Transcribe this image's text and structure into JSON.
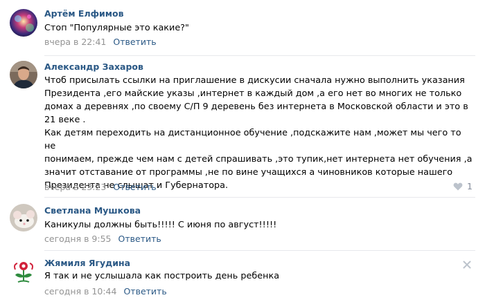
{
  "comments": [
    {
      "author": "Артём Елфимов",
      "text": "Стоп \"Популярные это какие?\"",
      "time": "вчера в 22:41",
      "reply": "Ответить",
      "avatar": "avatar-photo-colorful"
    },
    {
      "author": "Александр Захаров",
      "text": "Чтоб присылать ссылки на приглашение в дискусии сначала нужно выполнить указания\nПрезидента ,его майские указы ,интернет в каждый дом ,а его нет во многих не только\nдомах а деревнях ,по своему С/П 9 деревень без интернета в Московской области и это в\n21 веке .\nКак детям переходить на дистанционное обучение ,подскажите нам ,может мы чего то не\nпонимаем, прежде чем нам с детей спрашивать ,это тупик,нет интернета нет обучения ,а\nзначит отставание от программы ,не по вине учащихся а чиновников которые нашего\nПрезидента не слышат и Губернатора.",
      "time": "вчера в 23:23",
      "reply": "Ответить",
      "likes": "1",
      "avatar": "avatar-photo-man"
    },
    {
      "author": "Светлана Мушкова",
      "text": "Каникулы должны быть!!!!! С июня по август!!!!!",
      "time": "сегодня в 9:55",
      "reply": "Ответить",
      "avatar": "avatar-photo-mouse"
    },
    {
      "author": "Жямиля Ягудина",
      "text": "Я так и не услышала как построить день ребенка",
      "time": "сегодня в 10:44",
      "reply": "Ответить",
      "avatar": "avatar-ornament-flower"
    }
  ],
  "colors": {
    "link": "#2a5885",
    "meta": "#939393",
    "divider": "#e7e8ec",
    "icon": "#bcc3cc"
  },
  "icons": {
    "like": "heart-icon",
    "delete": "close-icon"
  }
}
